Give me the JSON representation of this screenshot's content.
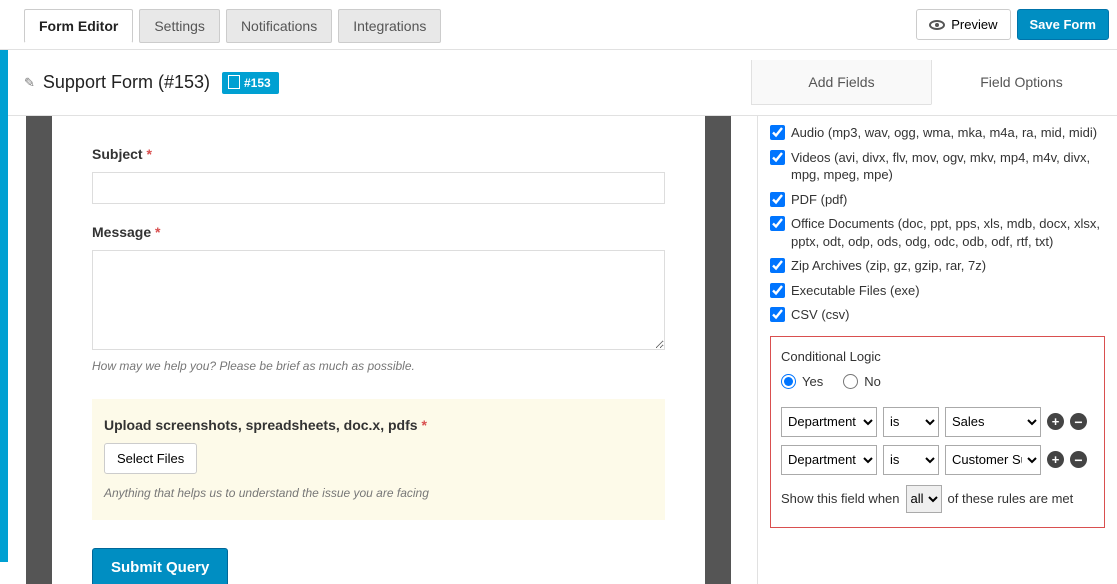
{
  "tabs": {
    "editor": "Form Editor",
    "settings": "Settings",
    "notifications": "Notifications",
    "integrations": "Integrations"
  },
  "actions": {
    "preview": "Preview",
    "save": "Save Form"
  },
  "form": {
    "title": "Support Form (#153)",
    "badge": "#153"
  },
  "sidebarTabs": {
    "add": "Add Fields",
    "options": "Field Options"
  },
  "fields": {
    "subject": {
      "label": "Subject"
    },
    "message": {
      "label": "Message",
      "desc": "How may we help you? Please be brief as much as possible."
    },
    "upload": {
      "label": "Upload screenshots, spreadsheets, doc.x, pdfs",
      "button": "Select Files",
      "desc": "Anything that helps us to understand the issue you are facing"
    },
    "submit": {
      "label": "Submit Query"
    }
  },
  "fileTypes": [
    "Audio (mp3, wav, ogg, wma, mka, m4a, ra, mid, midi)",
    "Videos (avi, divx, flv, mov, ogv, mkv, mp4, m4v, divx, mpg, mpeg, mpe)",
    "PDF (pdf)",
    "Office Documents (doc, ppt, pps, xls, mdb, docx, xlsx, pptx, odt, odp, ods, odg, odc, odb, odf, rtf, txt)",
    "Zip Archives (zip, gz, gzip, rar, 7z)",
    "Executable Files (exe)",
    "CSV (csv)"
  ],
  "cond": {
    "title": "Conditional Logic",
    "yes": "Yes",
    "no": "No",
    "rules": [
      {
        "field": "Department",
        "op": "is",
        "value": "Sales"
      },
      {
        "field": "Department",
        "op": "is",
        "value": "Customer Support"
      }
    ],
    "show1": "Show this field when",
    "show2": "of these rules are met",
    "match": "all"
  }
}
